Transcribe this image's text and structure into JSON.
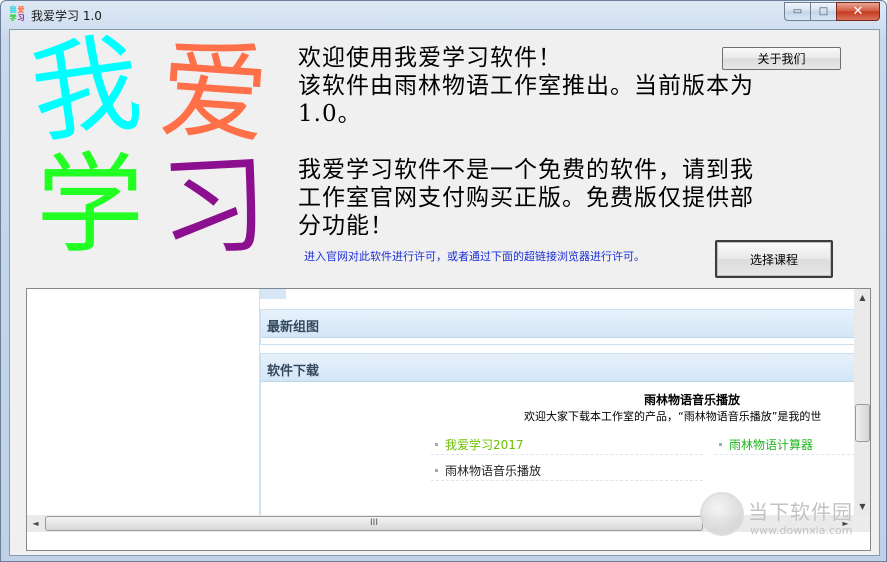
{
  "window": {
    "title": "我爱学习 1.0",
    "icon_chars": [
      "我",
      "爱",
      "学",
      "习"
    ],
    "caption": {
      "minimize": "▭",
      "maximize": "□",
      "close": "✕"
    }
  },
  "logo": {
    "chars": [
      "我",
      "爱",
      "学",
      "习"
    ],
    "colors": [
      "#00ffff",
      "#ff6f48",
      "#22ff22",
      "#8b0f8f"
    ]
  },
  "welcome": {
    "line1": "欢迎使用我爱学习软件！",
    "line2": "该软件由雨林物语工作室推出。当前版本为",
    "line3": "1.0。",
    "line4": "我爱学习软件不是一个免费的软件，请到我",
    "line5": "工作室官网支付购买正版。免费版仅提供部",
    "line6": "分功能！"
  },
  "hint": "进入官网对此软件进行许可，或者通过下面的超链接浏览器进行许可。",
  "buttons": {
    "about": "关于我们",
    "choose_course": "选择课程"
  },
  "browser": {
    "sections": {
      "news_title": "最新组图",
      "download_title": "软件下载"
    },
    "download": {
      "title": "雨林物语音乐播放",
      "description": "欢迎大家下载本工作室的产品，“雨林物语音乐播放”是我的世",
      "links": [
        "我爱学习2017",
        "雨林物语计算器",
        "雨林物语音乐播放"
      ]
    },
    "scroll": {
      "up": "▲",
      "down": "▼",
      "left": "◄",
      "right": "►",
      "grip": "III"
    }
  },
  "watermark": {
    "name": "当下软件园",
    "url": "www.downxia.com"
  }
}
